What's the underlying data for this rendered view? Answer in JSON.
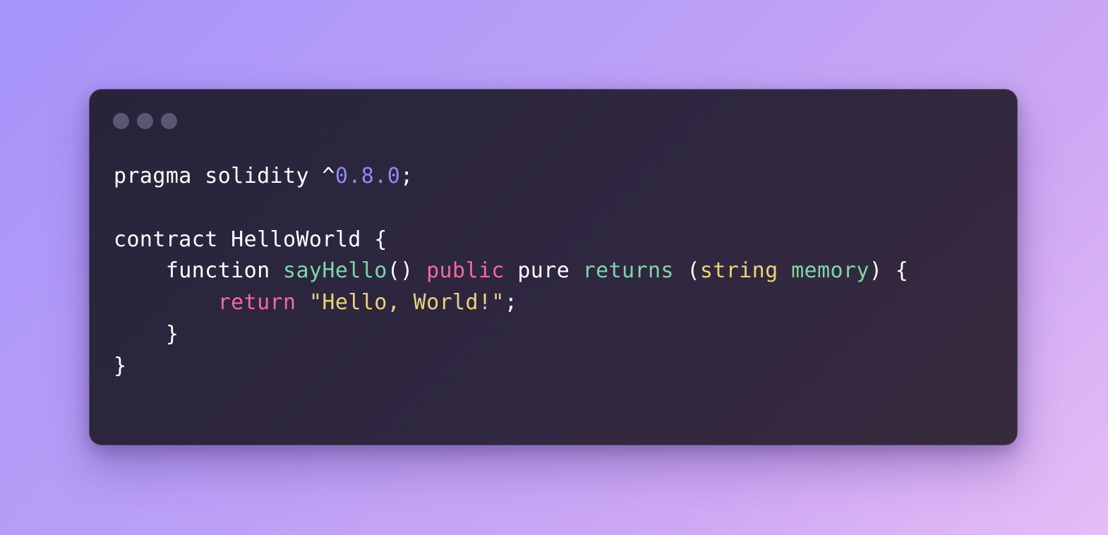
{
  "theme": {
    "plain": "#ffffff",
    "number": "#8b8cf4",
    "func": "#7ed6a6",
    "keyword": "#f16a9c",
    "string": "#e9d37a"
  },
  "window": {
    "controls": [
      "window-dot",
      "window-dot",
      "window-dot"
    ]
  },
  "code": {
    "lines": [
      [
        {
          "text": "pragma solidity ^",
          "type": "plain"
        },
        {
          "text": "0.8.0",
          "type": "number"
        },
        {
          "text": ";",
          "type": "plain"
        }
      ],
      [],
      [
        {
          "text": "contract HelloWorld {",
          "type": "plain"
        }
      ],
      [
        {
          "text": "    function ",
          "type": "plain"
        },
        {
          "text": "sayHello",
          "type": "func"
        },
        {
          "text": "() ",
          "type": "plain"
        },
        {
          "text": "public",
          "type": "keyword"
        },
        {
          "text": " pure ",
          "type": "plain"
        },
        {
          "text": "returns",
          "type": "func"
        },
        {
          "text": " (",
          "type": "plain"
        },
        {
          "text": "string",
          "type": "string"
        },
        {
          "text": " ",
          "type": "plain"
        },
        {
          "text": "memory",
          "type": "func"
        },
        {
          "text": ") {",
          "type": "plain"
        }
      ],
      [
        {
          "text": "        ",
          "type": "plain"
        },
        {
          "text": "return",
          "type": "keyword"
        },
        {
          "text": " ",
          "type": "plain"
        },
        {
          "text": "\"Hello, World!\"",
          "type": "string"
        },
        {
          "text": ";",
          "type": "plain"
        }
      ],
      [
        {
          "text": "    }",
          "type": "plain"
        }
      ],
      [
        {
          "text": "}",
          "type": "plain"
        }
      ]
    ]
  }
}
